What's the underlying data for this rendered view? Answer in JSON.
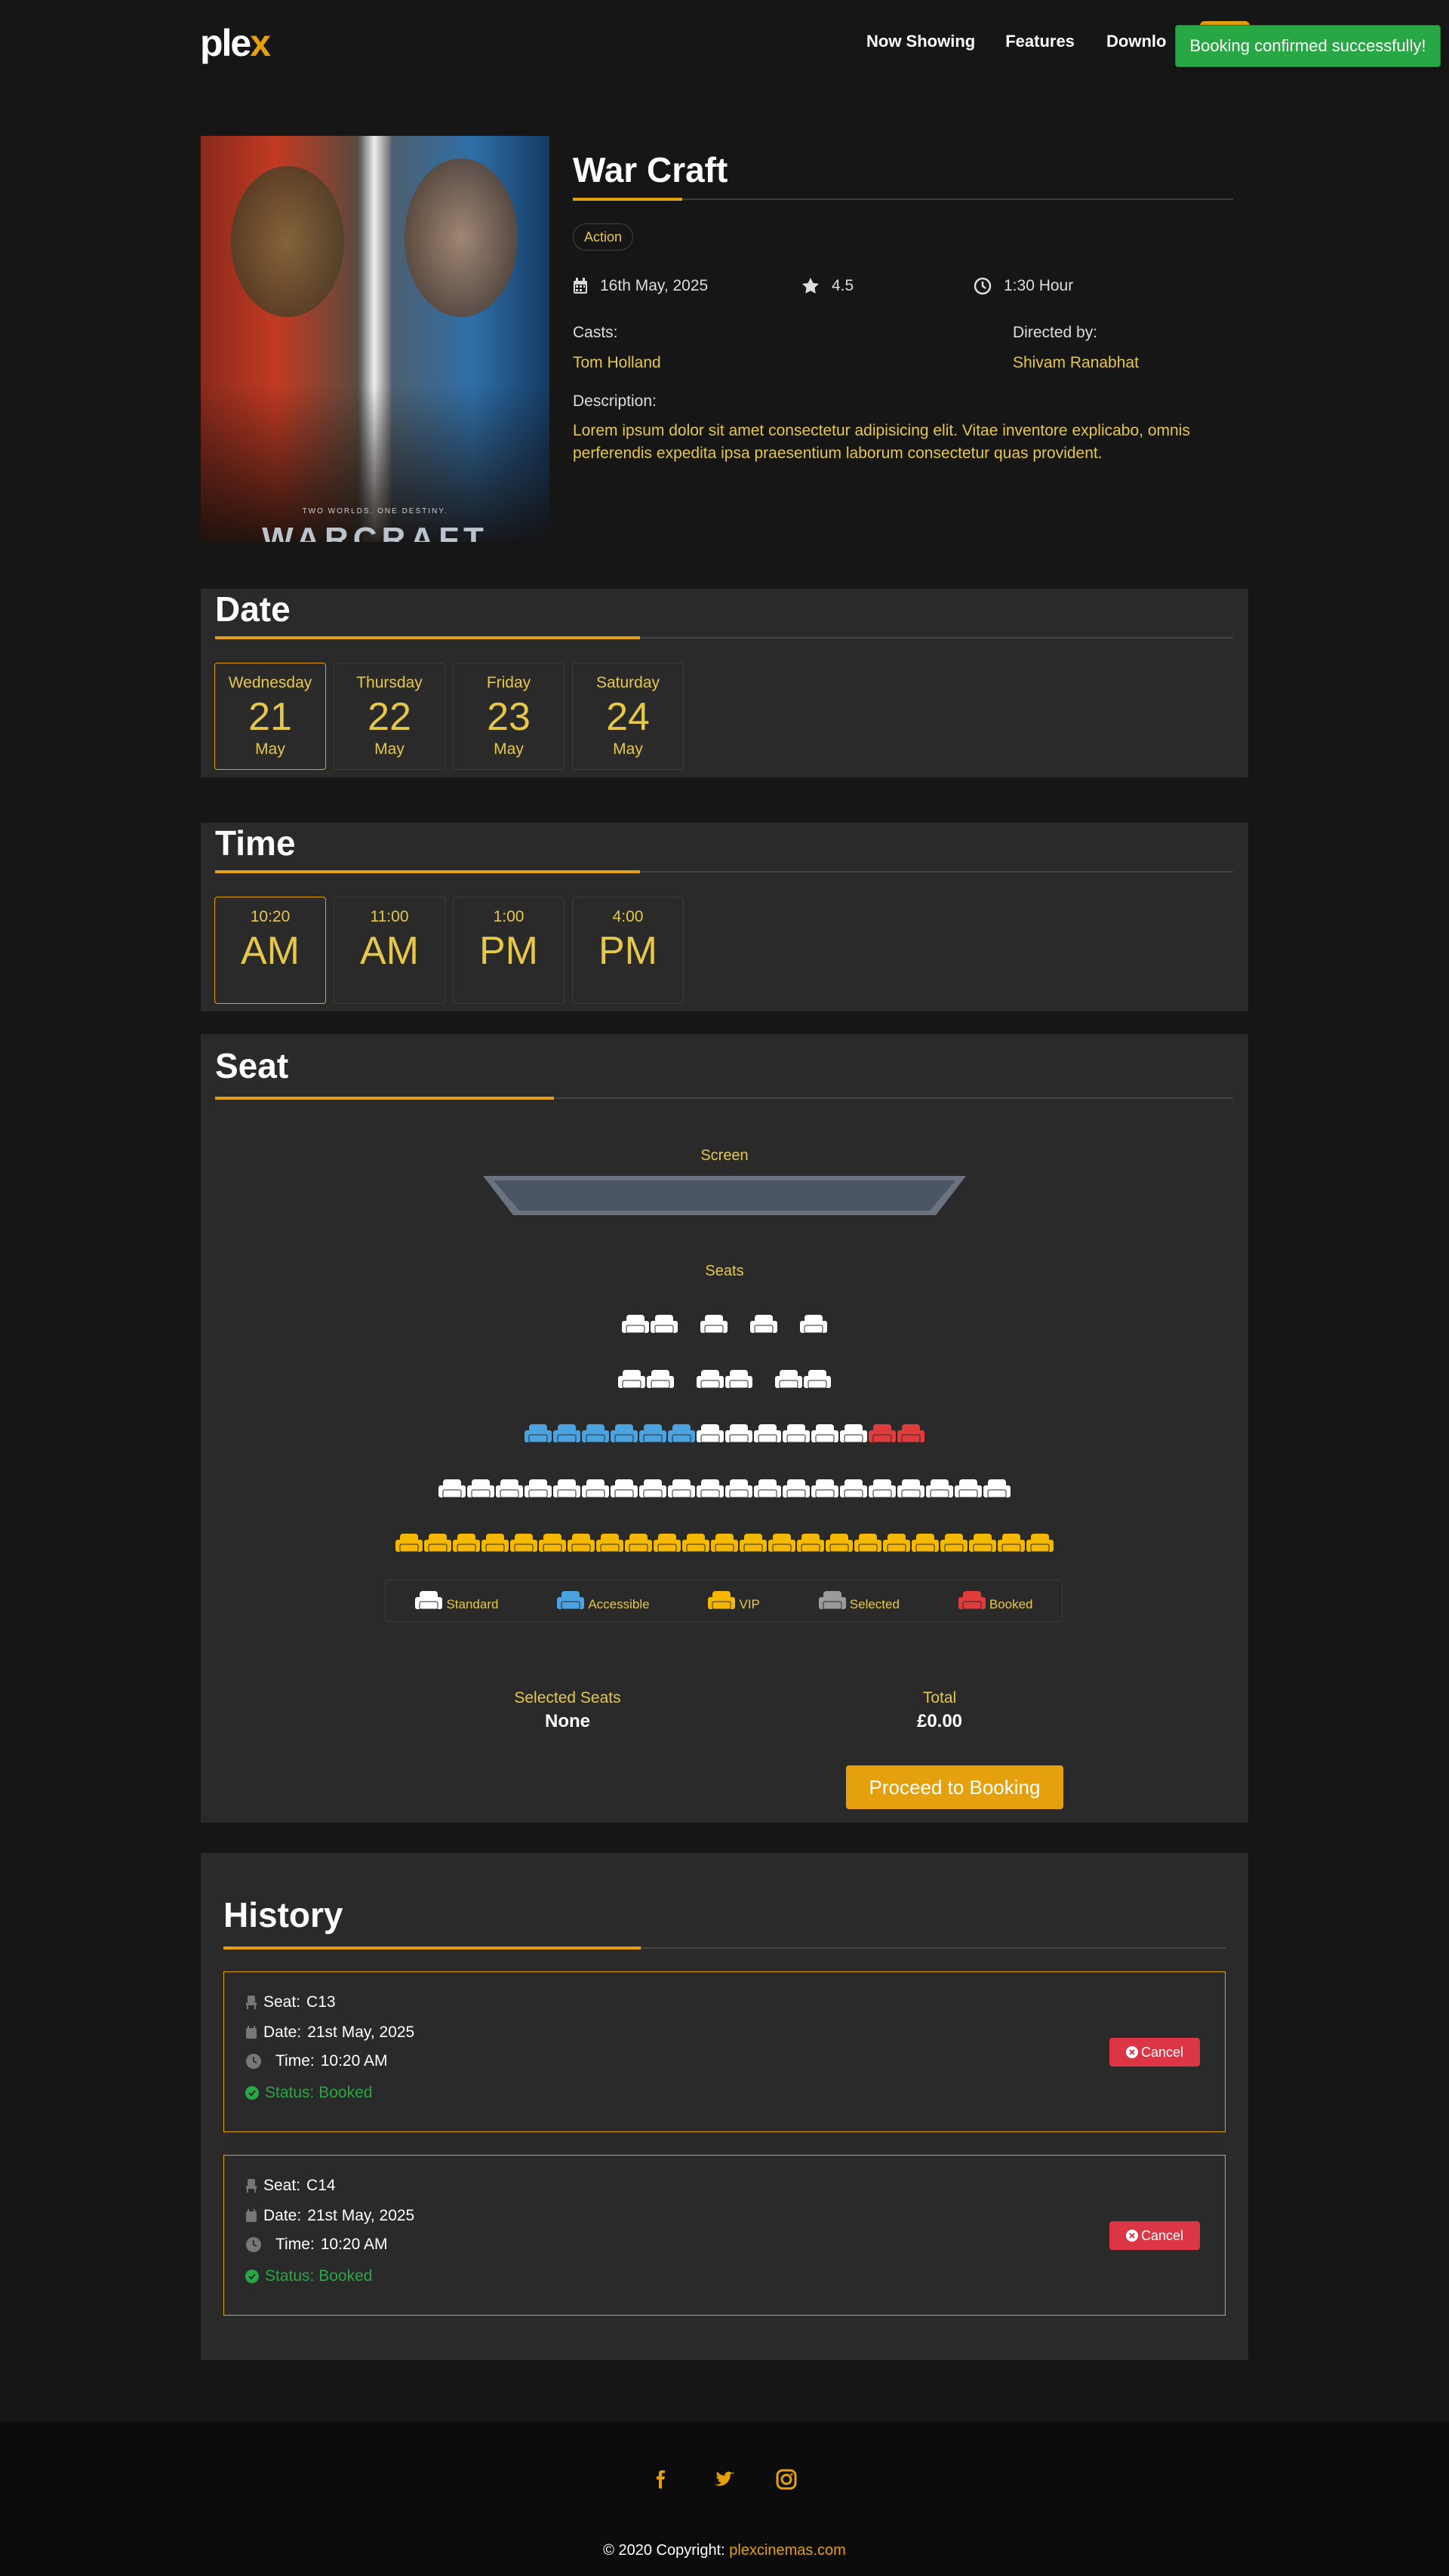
{
  "header": {
    "logo_main": "ple",
    "logo_accent": "x",
    "nav": [
      "Now Showing",
      "Features",
      "Download"
    ],
    "toast": "Booking confirmed successfully!"
  },
  "movie": {
    "poster_tagline": "TWO WORLDS. ONE DESTINY.",
    "poster_title": "WARCRAFT",
    "title": "War Craft",
    "genre": "Action",
    "date": "16th May, 2025",
    "rating": "4.5",
    "duration": "1:30 Hour",
    "casts_label": "Casts:",
    "casts": "Tom Holland",
    "directed_label": "Directed by:",
    "director": "Shivam Ranabhat",
    "description_label": "Description:",
    "description": "Lorem ipsum dolor sit amet consectetur adipisicing elit. Vitae inventore explicabo, omnis perferendis expedita ipsa praesentium laborum consectetur quas provident."
  },
  "date_section": {
    "title": "Date",
    "days": [
      {
        "day": "Wednesday",
        "num": "21",
        "month": "May",
        "selected": true
      },
      {
        "day": "Thursday",
        "num": "22",
        "month": "May",
        "selected": false
      },
      {
        "day": "Friday",
        "num": "23",
        "month": "May",
        "selected": false
      },
      {
        "day": "Saturday",
        "num": "24",
        "month": "May",
        "selected": false
      }
    ]
  },
  "time_section": {
    "title": "Time",
    "times": [
      {
        "time": "10:20",
        "period": "AM",
        "selected": true
      },
      {
        "time": "11:00",
        "period": "AM",
        "selected": false
      },
      {
        "time": "1:00",
        "period": "PM",
        "selected": false
      },
      {
        "time": "4:00",
        "period": "PM",
        "selected": false
      }
    ]
  },
  "seat_section": {
    "title": "Seat",
    "screen_label": "Screen",
    "seats_label": "Seats",
    "rows": [
      [
        "s",
        "s",
        "-",
        "s",
        "-",
        "s",
        "-",
        "s"
      ],
      [
        "s",
        "s",
        "-",
        "s",
        "s",
        "-",
        "s",
        "s"
      ],
      [
        "a",
        "a",
        "a",
        "a",
        "a",
        "a",
        "s",
        "s",
        "s",
        "s",
        "s",
        "s",
        "b",
        "b"
      ],
      [
        "s",
        "s",
        "s",
        "s",
        "s",
        "s",
        "s",
        "s",
        "s",
        "s",
        "s",
        "s",
        "s",
        "s",
        "s",
        "s",
        "s",
        "s",
        "s",
        "s"
      ],
      [
        "v",
        "v",
        "v",
        "v",
        "v",
        "v",
        "v",
        "v",
        "v",
        "v",
        "v",
        "v",
        "v",
        "v",
        "v",
        "v",
        "v",
        "v",
        "v",
        "v",
        "v",
        "v",
        "v"
      ]
    ],
    "legend": [
      {
        "key": "s",
        "label": "Standard"
      },
      {
        "key": "a",
        "label": "Accessible"
      },
      {
        "key": "v",
        "label": "VIP"
      },
      {
        "key": "x",
        "label": "Selected"
      },
      {
        "key": "b",
        "label": "Booked"
      }
    ],
    "seat_colors": {
      "s": "#ffffff",
      "a": "#4aa3df",
      "v": "#f5b800",
      "x": "#9a9a9a",
      "b": "#e03c3c"
    },
    "selected_label": "Selected Seats",
    "selected_value": "None",
    "total_label": "Total",
    "total_value": "£0.00",
    "proceed_label": "Proceed to Booking"
  },
  "history": {
    "title": "History",
    "items": [
      {
        "seat_label": "Seat:",
        "seat": "C13",
        "date_label": "Date:",
        "date": "21st May, 2025",
        "time_label": "Time:",
        "time": "10:20 AM",
        "status": "Status: Booked",
        "cancel": "Cancel"
      },
      {
        "seat_label": "Seat:",
        "seat": "C14",
        "date_label": "Date:",
        "date": "21st May, 2025",
        "time_label": "Time:",
        "time": "10:20 AM",
        "status": "Status: Booked",
        "cancel": "Cancel"
      }
    ]
  },
  "footer": {
    "social": [
      "facebook-icon",
      "twitter-icon",
      "instagram-icon"
    ],
    "copyright": "© 2020 Copyright:",
    "link": "plexcinemas.com"
  }
}
